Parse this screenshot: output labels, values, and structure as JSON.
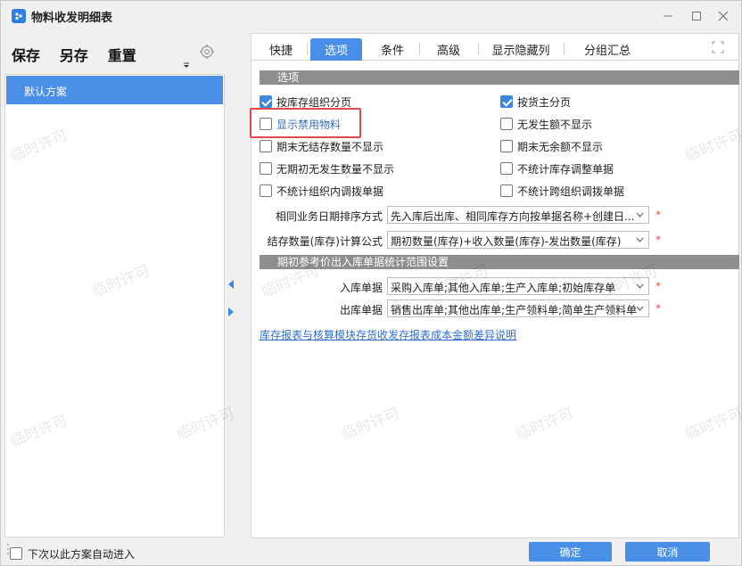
{
  "window": {
    "title": "物料收发明细表"
  },
  "left": {
    "actions": [
      "保存",
      "另存",
      "重置"
    ],
    "schemes": [
      {
        "label": "默认方案",
        "selected": true
      }
    ],
    "auto_enter": {
      "label": "下次以此方案自动进入",
      "checked": false
    }
  },
  "tabs": [
    {
      "label": "快捷",
      "active": false
    },
    {
      "label": "选项",
      "active": true
    },
    {
      "label": "条件",
      "active": false
    },
    {
      "label": "高级",
      "active": false
    },
    {
      "label": "显示隐藏列",
      "active": false
    },
    {
      "label": "分组汇总",
      "active": false
    }
  ],
  "options": {
    "section_title": "选项",
    "left_col": [
      {
        "label": "按库存组织分页",
        "checked": true
      },
      {
        "label": "显示禁用物料",
        "checked": false,
        "highlighted": true
      },
      {
        "label": "期末无结存数量不显示",
        "checked": false
      },
      {
        "label": "无期初无发生数量不显示",
        "checked": false
      },
      {
        "label": "不统计组织内调拨单据",
        "checked": false
      }
    ],
    "right_col": [
      {
        "label": "按货主分页",
        "checked": true
      },
      {
        "label": "无发生额不显示",
        "checked": false
      },
      {
        "label": "期末无余额不显示",
        "checked": false
      },
      {
        "label": "不统计库存调整单据",
        "checked": false
      },
      {
        "label": "不统计跨组织调拨单据",
        "checked": false
      }
    ],
    "sort_mode": {
      "label": "相同业务日期排序方式",
      "value": "先入库后出库、相同库存方向按单据名称+创建日..."
    },
    "balance_formula": {
      "label": "结存数量(库存)计算公式",
      "value": "期初数量(库存)+收入数量(库存)-发出数量(库存)"
    }
  },
  "range": {
    "section_title": "期初参考价出入库单据统计范围设置",
    "inbound": {
      "label": "入库单据",
      "value": "采购入库单;其他入库单;生产入库单;初始库存单"
    },
    "outbound": {
      "label": "出库单据",
      "value": "销售出库单;其他出库单;生产领料单;简单生产领料单"
    }
  },
  "link": "库存报表与核算模块存货收发存报表成本金额差异说明",
  "footer": {
    "ok": "确定",
    "cancel": "取消"
  },
  "required_mark": "*",
  "watermark": "临时许可",
  "colors": {
    "accent": "#4a8fe7",
    "highlight_border": "#e0484e",
    "section_header": "#8e8e8e",
    "link": "#2f6fd0"
  }
}
